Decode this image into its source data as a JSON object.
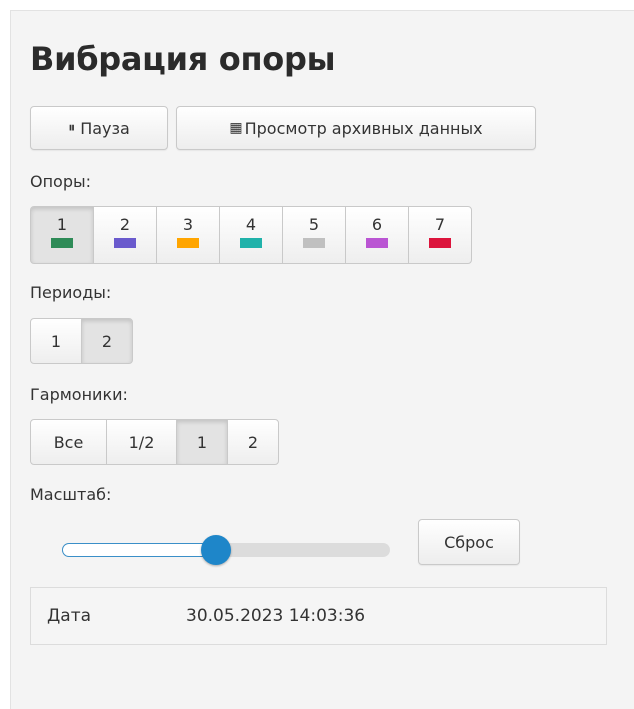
{
  "title": "Вибрация опоры",
  "toolbar": {
    "pause": {
      "icon": "⏸",
      "label": "Пауза"
    },
    "archive": {
      "icon": "▦",
      "label": "Просмотр архивных данных"
    }
  },
  "supports": {
    "label": "Опоры:",
    "items": [
      {
        "num": "1",
        "color": "#2e8b57",
        "active": true
      },
      {
        "num": "2",
        "color": "#6a5acd",
        "active": false
      },
      {
        "num": "3",
        "color": "#ffa500",
        "active": false
      },
      {
        "num": "4",
        "color": "#20b2aa",
        "active": false
      },
      {
        "num": "5",
        "color": "#c0c0c0",
        "active": false
      },
      {
        "num": "6",
        "color": "#ba55d3",
        "active": false
      },
      {
        "num": "7",
        "color": "#dc143c",
        "active": false
      }
    ]
  },
  "periods": {
    "label": "Периоды:",
    "items": [
      {
        "label": "1",
        "active": false
      },
      {
        "label": "2",
        "active": true
      }
    ]
  },
  "harmonics": {
    "label": "Гармоники:",
    "items": [
      {
        "label": "Все",
        "active": false
      },
      {
        "label": "1/2",
        "active": false
      },
      {
        "label": "1",
        "active": true
      },
      {
        "label": "2",
        "active": false
      }
    ]
  },
  "scale": {
    "label": "Масштаб:",
    "value_fraction": 0.47,
    "reset_label": "Сброс"
  },
  "info": {
    "date_label": "Дата",
    "date_value": "30.05.2023 14:03:36"
  }
}
